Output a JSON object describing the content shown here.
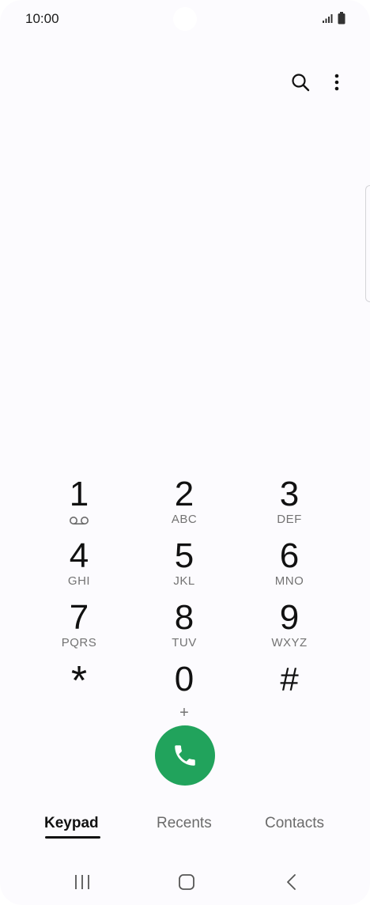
{
  "status": {
    "time": "10:00"
  },
  "top_bar": {
    "search_icon": "search-icon",
    "more_icon": "more-vert-icon"
  },
  "keypad": {
    "keys": [
      {
        "digit": "1",
        "letters": "",
        "icon": "voicemail-icon"
      },
      {
        "digit": "2",
        "letters": "ABC"
      },
      {
        "digit": "3",
        "letters": "DEF"
      },
      {
        "digit": "4",
        "letters": "GHI"
      },
      {
        "digit": "5",
        "letters": "JKL"
      },
      {
        "digit": "6",
        "letters": "MNO"
      },
      {
        "digit": "7",
        "letters": "PQRS"
      },
      {
        "digit": "8",
        "letters": "TUV"
      },
      {
        "digit": "9",
        "letters": "WXYZ"
      },
      {
        "digit": "*",
        "letters": ""
      },
      {
        "digit": "0",
        "letters": "+"
      },
      {
        "digit": "#",
        "letters": ""
      }
    ]
  },
  "call_button": {
    "icon": "phone-icon",
    "color": "#21a35c"
  },
  "tabs": [
    {
      "label": "Keypad",
      "active": true
    },
    {
      "label": "Recents",
      "active": false
    },
    {
      "label": "Contacts",
      "active": false
    }
  ],
  "nav": {
    "recents_icon": "recents-icon",
    "home_icon": "home-icon",
    "back_icon": "back-icon"
  }
}
